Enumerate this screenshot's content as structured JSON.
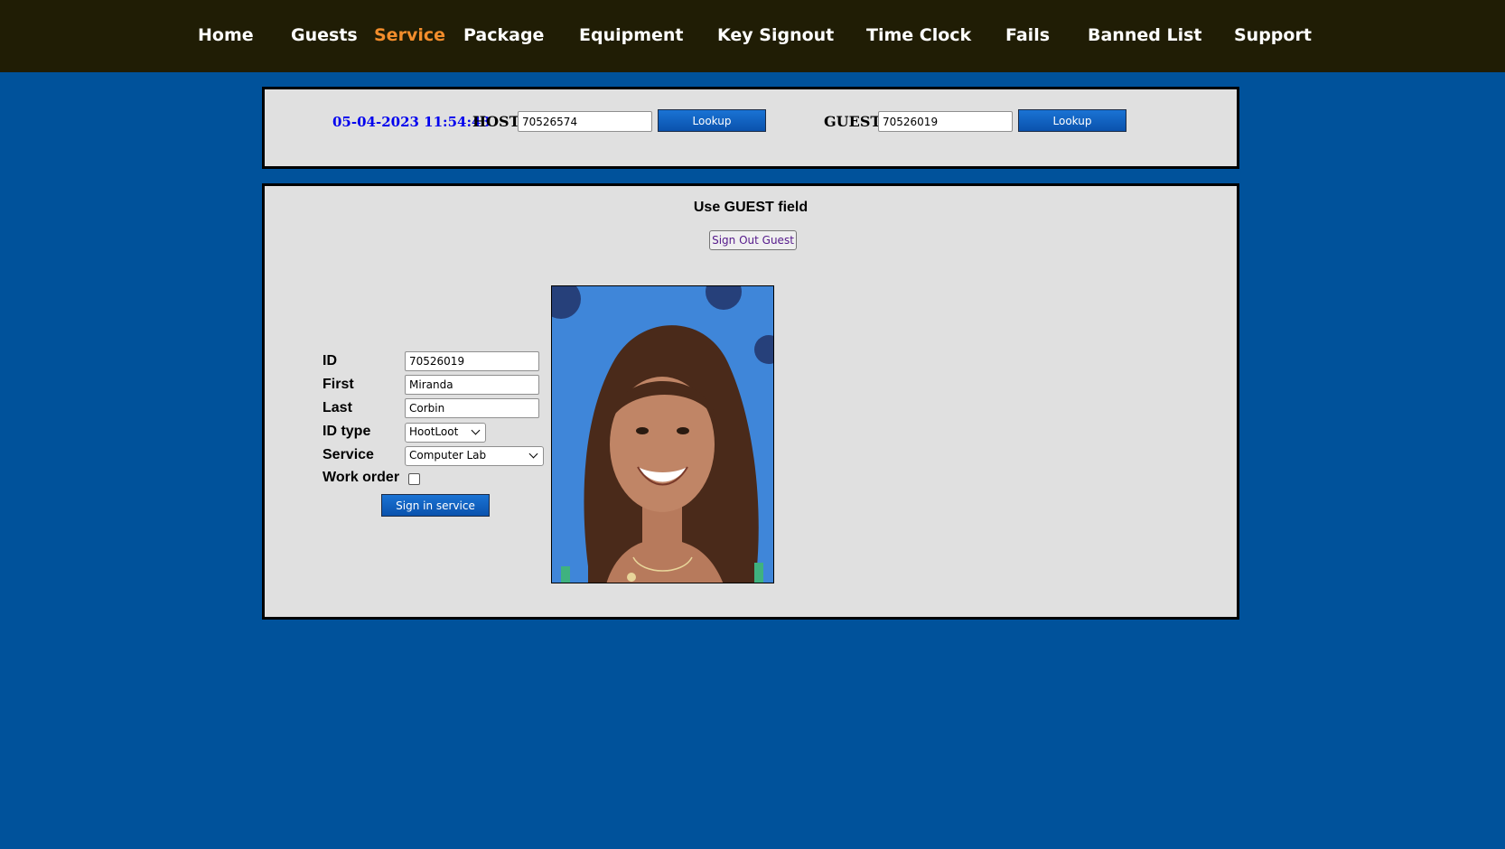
{
  "nav": {
    "items": [
      {
        "label": "Home"
      },
      {
        "label": "Guests"
      },
      {
        "label": "Service",
        "active": true
      },
      {
        "label": "Package"
      },
      {
        "label": "Equipment"
      },
      {
        "label": "Key Signout"
      },
      {
        "label": "Time Clock"
      },
      {
        "label": "Fails"
      },
      {
        "label": "Banned List"
      },
      {
        "label": "Support"
      }
    ]
  },
  "lookup": {
    "datetime": "05-04-2023 11:54:43",
    "host_label": "HOST",
    "host_value": "70526574",
    "host_button": "Lookup",
    "guest_label": "GUEST",
    "guest_value": "70526019",
    "guest_button": "Lookup"
  },
  "service_panel": {
    "heading": "Use GUEST field",
    "signout_button": "Sign Out Guest",
    "form": {
      "id_label": "ID",
      "id_value": "70526019",
      "first_label": "First",
      "first_value": "Miranda",
      "last_label": "Last",
      "last_value": "Corbin",
      "idtype_label": "ID type",
      "idtype_value": "HootLoot",
      "service_label": "Service",
      "service_value": "Computer Lab",
      "workorder_label": "Work order",
      "workorder_checked": false,
      "submit_button": "Sign in service"
    },
    "photo": {
      "icon": "guest-photo"
    }
  },
  "colors": {
    "page_bg": "#00529b",
    "nav_bg": "#201d05",
    "nav_active": "#f28d2c",
    "panel_bg": "#e0e0e0",
    "datetime": "#0000ee",
    "button_blue": "#0a52ad"
  }
}
